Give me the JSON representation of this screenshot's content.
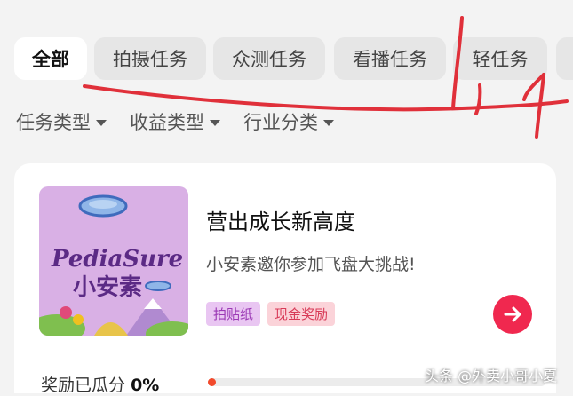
{
  "tabs": [
    {
      "label": "全部",
      "active": true
    },
    {
      "label": "拍摄任务",
      "active": false
    },
    {
      "label": "众测任务",
      "active": false
    },
    {
      "label": "看播任务",
      "active": false
    },
    {
      "label": "轻任务",
      "active": false
    }
  ],
  "filters": [
    "任务类型",
    "收益类型",
    "行业分类"
  ],
  "card": {
    "title": "营出成长新高度",
    "description": "小安素邀你参加飞盘大挑战!",
    "tags": [
      "拍贴纸",
      "现金奖励"
    ],
    "thumbnail": {
      "brand": "PediaSure",
      "brand_cn": "小安素"
    },
    "reward_label": "奖励已瓜分",
    "reward_percent": "0%"
  },
  "watermark": "头条 @外卖小哥小夏",
  "colors": {
    "accent_red": "#f0284f",
    "tag_purple": "#9b39b5",
    "tag_pink": "#d83a57",
    "progress": "#f24a2c",
    "thumb_bg": "#d9b0e5"
  }
}
